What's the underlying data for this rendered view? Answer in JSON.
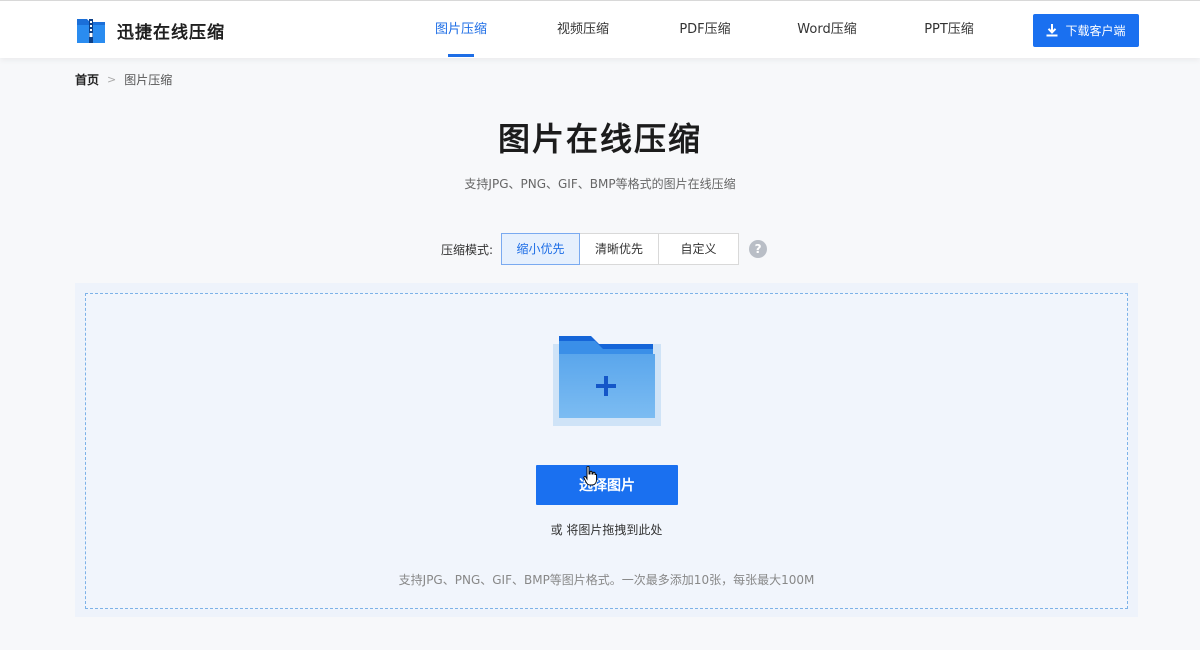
{
  "brand": {
    "name": "迅捷在线压缩",
    "primary_color": "#1a70f0"
  },
  "nav": {
    "items": [
      {
        "label": "图片压缩",
        "active": true
      },
      {
        "label": "视频压缩",
        "active": false
      },
      {
        "label": "PDF压缩",
        "active": false
      },
      {
        "label": "Word压缩",
        "active": false
      },
      {
        "label": "PPT压缩",
        "active": false
      }
    ],
    "download_label": "下载客户端"
  },
  "breadcrumb": {
    "home": "首页",
    "separator": ">",
    "current": "图片压缩"
  },
  "main": {
    "title": "图片在线压缩",
    "subtitle": "支持JPG、PNG、GIF、BMP等格式的图片在线压缩"
  },
  "mode": {
    "label": "压缩模式:",
    "options": [
      {
        "label": "缩小优先",
        "active": true
      },
      {
        "label": "清晰优先",
        "active": false
      },
      {
        "label": "自定义",
        "active": false
      }
    ],
    "help": "?"
  },
  "upload": {
    "folder_icon": "folder-plus-icon",
    "button_label": "选择图片",
    "drag_hint": "或 将图片拖拽到此处",
    "format_hint": "支持JPG、PNG、GIF、BMP等图片格式。一次最多添加10张，每张最大100M"
  }
}
